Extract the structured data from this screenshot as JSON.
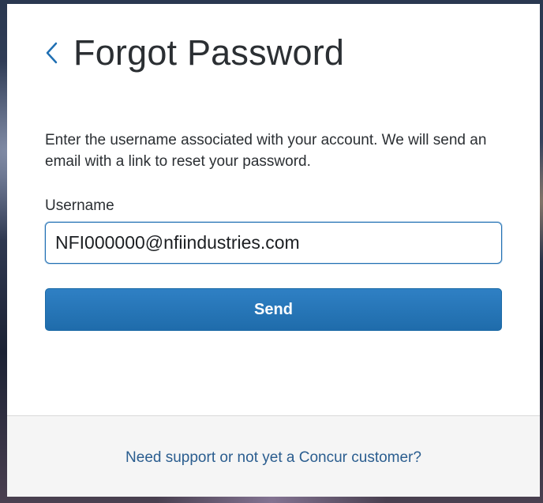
{
  "header": {
    "back_icon": "chevron-left-icon",
    "title": "Forgot Password"
  },
  "form": {
    "instructions": "Enter the username associated with your account. We will send an email with a link to reset your password.",
    "username_label": "Username",
    "username_value": "NFI000000@nfiindustries.com",
    "send_label": "Send"
  },
  "footer": {
    "support_link": "Need support or not yet a Concur customer?"
  },
  "colors": {
    "accent": "#1f6fb3",
    "button": "#2a78bb",
    "link": "#2a5d8f",
    "footer_bg": "#f5f5f5"
  }
}
